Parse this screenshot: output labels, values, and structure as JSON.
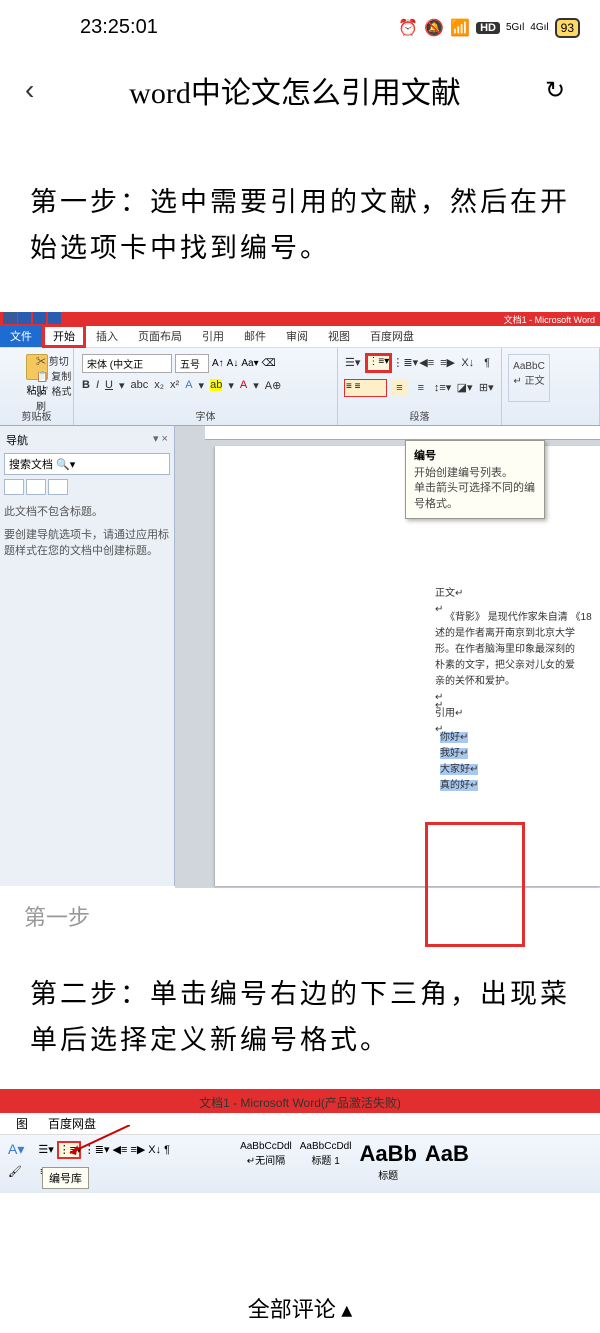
{
  "status": {
    "time": "23:25:01",
    "hd": "HD",
    "sig5g": "5G",
    "sig4g": "4G",
    "battery": "93"
  },
  "header": {
    "title": "word中论文怎么引用文献"
  },
  "step1": {
    "text": "第一步：选中需要引用的文献，然后在开始选项卡中找到编号。",
    "caption": "第一步"
  },
  "word1": {
    "titlebar": "文档1 - Microsoft Word",
    "tabs": {
      "file": "文件",
      "home": "开始",
      "insert": "插入",
      "layout": "页面布局",
      "ref": "引用",
      "mail": "邮件",
      "review": "审阅",
      "view": "视图",
      "baidu": "百度网盘"
    },
    "clipboard": {
      "paste": "粘贴",
      "cut": "剪切",
      "copy": "复制",
      "format": "格式刷",
      "label": "剪贴板"
    },
    "font": {
      "name": "宋体 (中文正",
      "size": "五号",
      "label": "字体"
    },
    "para": {
      "label": "段落"
    },
    "styles": {
      "normal": "AaBbC",
      "normal2": "↵ 正文"
    },
    "nav": {
      "title": "导航",
      "search": "搜索文档",
      "msg1": "此文档不包含标题。",
      "msg2": "要创建导航选项卡，请通过应用标题样式在您的文档中创建标题。"
    },
    "tooltip": {
      "title": "编号",
      "line1": "开始创建编号列表。",
      "line2": "单击箭头可选择不同的编号格式。"
    },
    "doc": {
      "zhengwen": "正文↵",
      "para1": "《背影》 是现代作家朱自清 《18",
      "para2": "述的是作者离开南京到北京大学",
      "para3": "形。在作者脑海里印象最深刻的",
      "para4": "朴素的文字，把父亲对儿女的爱",
      "para5": "亲的关怀和爱护。",
      "yinyong": "引用↵",
      "cite1": "你好↵",
      "cite2": "我好↵",
      "cite3": "大家好↵",
      "cite4": "真的好↵"
    }
  },
  "step2": {
    "text": "第二步：单击编号右边的下三角，出现菜单后选择定义新编号格式。"
  },
  "word2": {
    "titlebar": "文档1 - Microsoft Word(产品激活失败)",
    "tabs": {
      "view": "图",
      "baidu": "百度网盘"
    },
    "numlib": "编号库",
    "styles": {
      "s1": "AaBbCcDdl",
      "s1b": "↵无间隔",
      "s2": "AaBbCcDdl",
      "s2b": "标题 1",
      "s3": "AaBb",
      "s3b": "标题",
      "s4": "AaB"
    }
  },
  "bottom": {
    "label": "全部评论 ▴"
  }
}
